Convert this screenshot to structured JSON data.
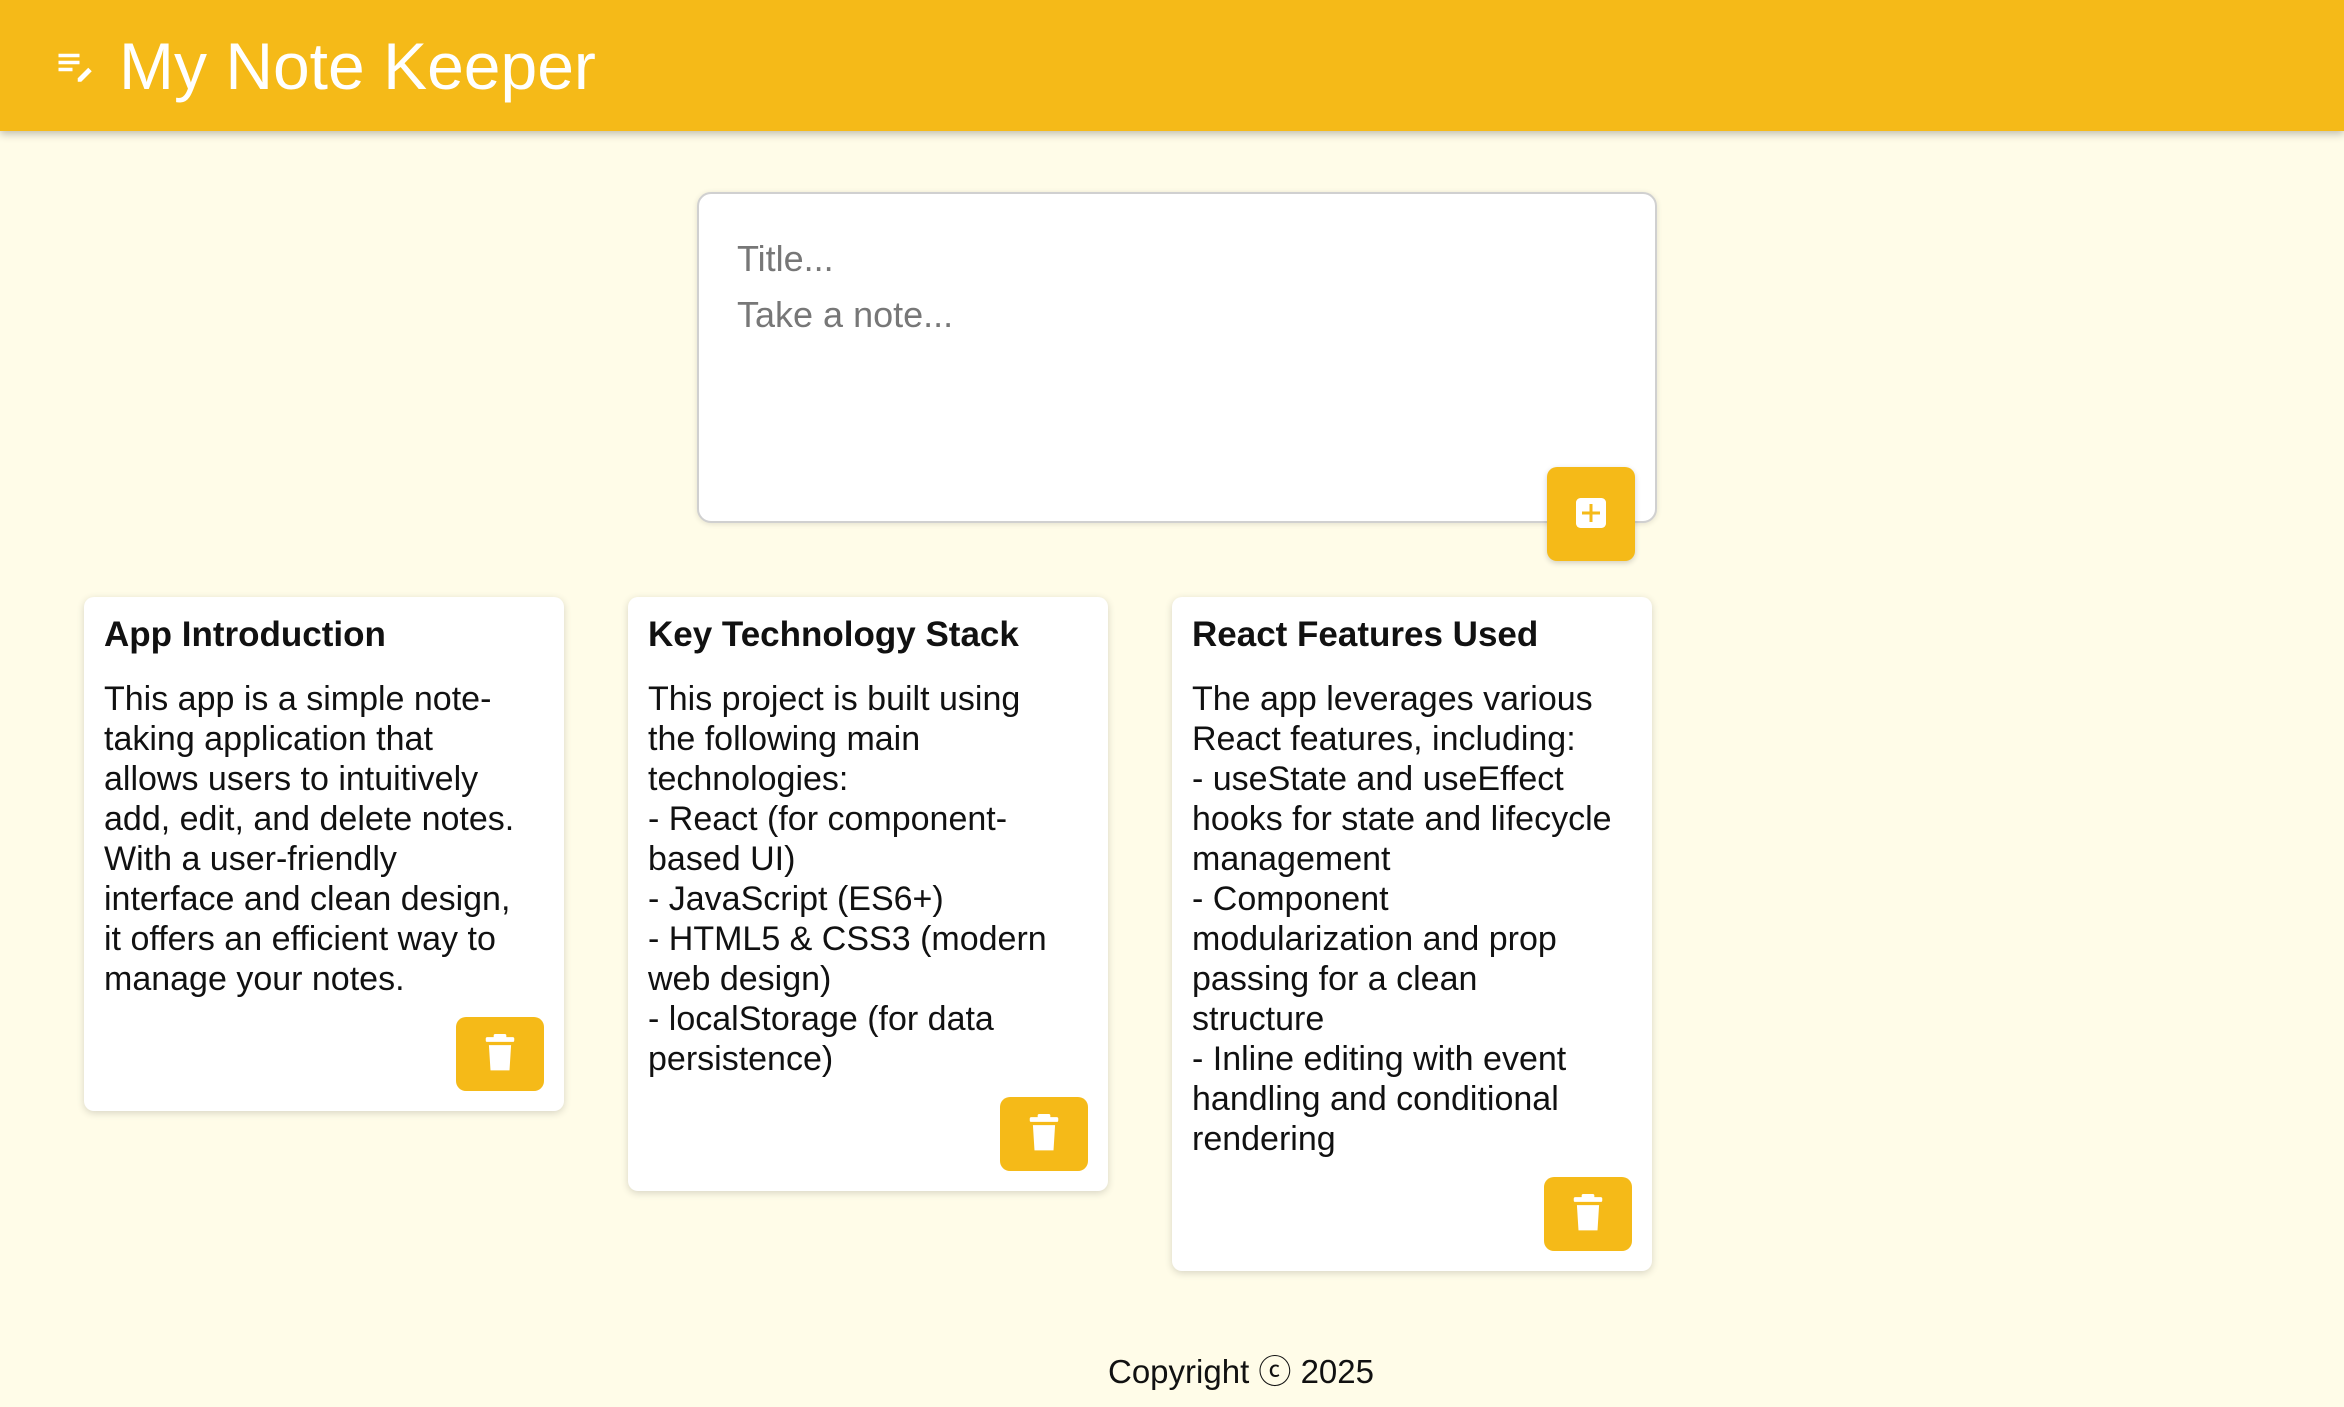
{
  "header": {
    "title": "My Note Keeper",
    "icon": "note-edit-icon"
  },
  "create_area": {
    "title_placeholder": "Title...",
    "content_placeholder": "Take a note...",
    "add_icon": "add-box-icon"
  },
  "notes": [
    {
      "title": "App Introduction",
      "content": "This app is a simple note-\ntaking application that\nallows users to intuitively\nadd, edit, and delete notes.\nWith a user-friendly\ninterface and clean design,\nit offers an efficient way to\nmanage your notes."
    },
    {
      "title": "Key Technology Stack",
      "content": "This project is built using\nthe following main\ntechnologies:\n- React (for component-\nbased UI)\n- JavaScript (ES6+)\n- HTML5 & CSS3 (modern\nweb design)\n- localStorage (for data\npersistence)"
    },
    {
      "title": "React Features Used",
      "content": "The app leverages various\nReact features, including:\n- useState and useEffect\nhooks for state and lifecycle\nmanagement\n- Component\nmodularization and prop\npassing for a clean\nstructure\n- Inline editing with event\nhandling and conditional\nrendering"
    }
  ],
  "footer": {
    "text": "Copyright ⓒ 2025"
  },
  "colors": {
    "accent": "#F5BA18",
    "background": "#FFFCE8",
    "card": "#FFFFFF"
  }
}
